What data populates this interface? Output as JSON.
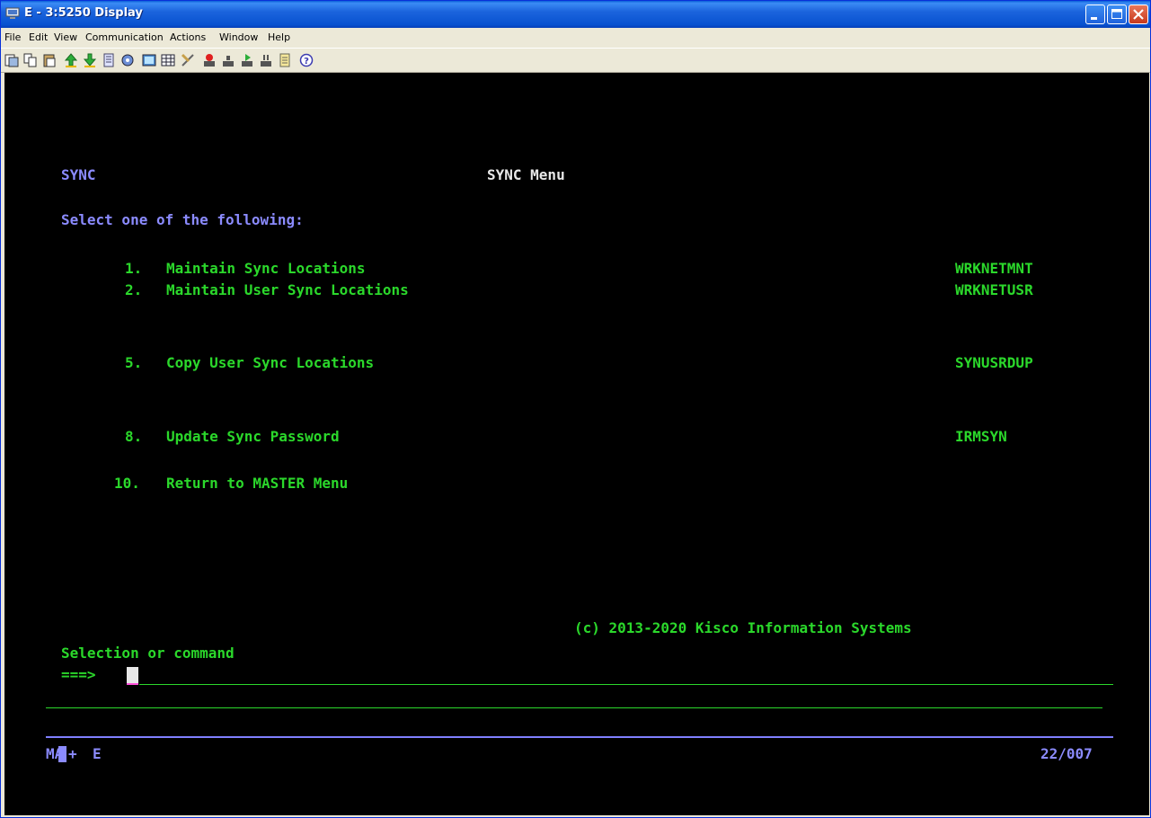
{
  "window": {
    "title": "E - 3:5250 Display"
  },
  "menu": [
    "File",
    "Edit",
    "View",
    "Communication",
    "Actions",
    "Window",
    "Help"
  ],
  "toolbar_icons": [
    "copy-screen-icon",
    "copy-icon",
    "paste-icon",
    "send-icon",
    "receive-icon",
    "print-icon",
    "macro-icon",
    "keypad-icon",
    "table-icon",
    "clear-icon",
    "record-icon",
    "stop-icon",
    "play-icon",
    "pause-icon",
    "notes-icon",
    "help-icon"
  ],
  "screen": {
    "menu_id": "SYNC",
    "menu_title": "SYNC Menu",
    "prompt": "Select one of the following:",
    "options": [
      {
        "num": "1.",
        "label": "Maintain Sync Locations",
        "cmd": "WRKNETMNT"
      },
      {
        "num": "2.",
        "label": "Maintain User Sync Locations",
        "cmd": "WRKNETUSR"
      },
      {
        "num": "5.",
        "label": "Copy User Sync Locations",
        "cmd": "SYNUSRDUP"
      },
      {
        "num": "8.",
        "label": "Update Sync Password",
        "cmd": "IRMSYN"
      },
      {
        "num": "10.",
        "label": "Return to MASTER Menu",
        "cmd": ""
      }
    ],
    "copyright": "(c) 2013-2020 Kisco Information Systems",
    "selection_label": "Selection or command",
    "command_prompt": "===>",
    "command_value": ""
  },
  "status": {
    "mode": "MA",
    "plus": "+",
    "session": "E",
    "cursor_pos": "22/007"
  },
  "colors": {
    "green": "#2bd82b",
    "blue": "#8b8bff",
    "background": "#000000"
  }
}
